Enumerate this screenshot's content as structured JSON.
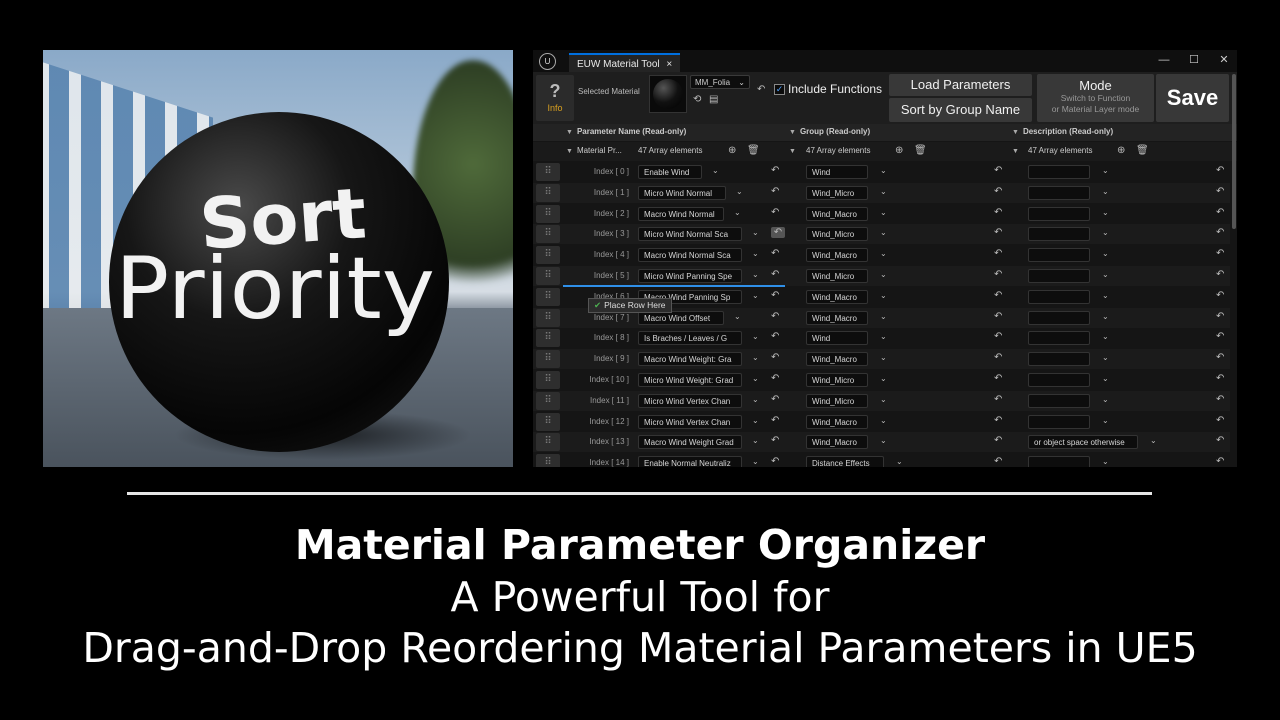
{
  "render": {
    "word1": "Sort",
    "word2": "Priority"
  },
  "window": {
    "app_icon": "unreal-engine-icon",
    "tab_title": "EUW Material Tool",
    "tab_close": "×",
    "minimize": "—",
    "maximize": "☐",
    "close": "✕"
  },
  "toolbar": {
    "info_icon": "?",
    "info_label": "Info",
    "selected_material_label": "Selected Material",
    "material_name": "MM_Folia",
    "include_functions_label": "Include Functions",
    "include_functions_checked": true,
    "load_parameters_label": "Load Parameters",
    "sort_label": "Sort by Group Name",
    "mode_title": "Mode",
    "mode_sub1": "Switch to Function",
    "mode_sub2": "or Material Layer mode",
    "save_label": "Save"
  },
  "columns": {
    "param_header": "Parameter Name (Read-only)",
    "group_header": "Group (Read-only)",
    "desc_header": "Description (Read-only)",
    "param_array_label": "Material Pr...",
    "array_count": "47 Array elements"
  },
  "drag": {
    "tooltip": "Place Row Here"
  },
  "rows": [
    {
      "index": "Index [ 0 ]",
      "param": "Enable Wind",
      "group": "Wind",
      "desc": ""
    },
    {
      "index": "Index [ 1 ]",
      "param": "Micro Wind Normal",
      "group": "Wind_Micro",
      "desc": ""
    },
    {
      "index": "Index [ 2 ]",
      "param": "Macro Wind Normal",
      "group": "Wind_Macro",
      "desc": ""
    },
    {
      "index": "Index [ 3 ]",
      "param": "Micro Wind Normal Sca",
      "group": "Wind_Micro",
      "desc": ""
    },
    {
      "index": "Index [ 4 ]",
      "param": "Macro Wind Normal Sca",
      "group": "Wind_Macro",
      "desc": ""
    },
    {
      "index": "Index [ 5 ]",
      "param": "Micro Wind Panning Spe",
      "group": "Wind_Micro",
      "desc": ""
    },
    {
      "index": "Index [ 6 ]",
      "param": "Macro Wind Panning Sp",
      "group": "Wind_Macro",
      "desc": ""
    },
    {
      "index": "Index [ 7 ]",
      "param": "Macro Wind Offset",
      "group": "Wind_Macro",
      "desc": ""
    },
    {
      "index": "Index [ 8 ]",
      "param": "Is Braches / Leaves / G",
      "group": "Wind",
      "desc": ""
    },
    {
      "index": "Index [ 9 ]",
      "param": "Macro Wind Weight: Gra",
      "group": "Wind_Macro",
      "desc": ""
    },
    {
      "index": "Index [ 10 ]",
      "param": "Micro Wind Weight: Grad",
      "group": "Wind_Micro",
      "desc": ""
    },
    {
      "index": "Index [ 11 ]",
      "param": "Micro Wind Vertex Chan",
      "group": "Wind_Micro",
      "desc": ""
    },
    {
      "index": "Index [ 12 ]",
      "param": "Micro Wind Vertex Chan",
      "group": "Wind_Macro",
      "desc": ""
    },
    {
      "index": "Index [ 13 ]",
      "param": "Macro Wind Weight Grad",
      "group": "Wind_Macro",
      "desc": "or object space otherwise"
    },
    {
      "index": "Index [ 14 ]",
      "param": "Enable Normal Neutraliz",
      "group": "Distance Effects",
      "desc": ""
    }
  ],
  "caption": {
    "title": "Material Parameter Organizer",
    "line2": "A Powerful Tool for",
    "line3": "Drag-and-Drop Reordering Material Parameters in UE5"
  }
}
